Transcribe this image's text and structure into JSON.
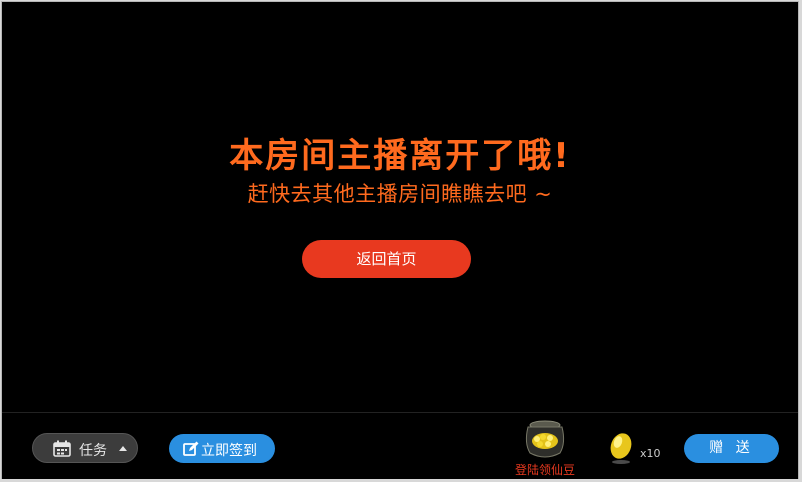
{
  "notice": {
    "headline": "本房间主播离开了哦!",
    "subline": "赶快去其他主播房间瞧瞧去吧 ~",
    "home_button": "返回首页"
  },
  "toolbar": {
    "task_label": "任务",
    "signin_label": "立即签到",
    "pot_label": "登陆领仙豆",
    "bean_count": "x10",
    "gift_label": "赠 送"
  },
  "colors": {
    "accent_orange": "#ff6a1e",
    "button_red": "#e8391f",
    "button_blue": "#2a8fe0"
  },
  "icons": {
    "task": "calendar-icon",
    "signin": "edit-icon",
    "pot": "bean-pot-icon",
    "bean": "bean-icon"
  }
}
